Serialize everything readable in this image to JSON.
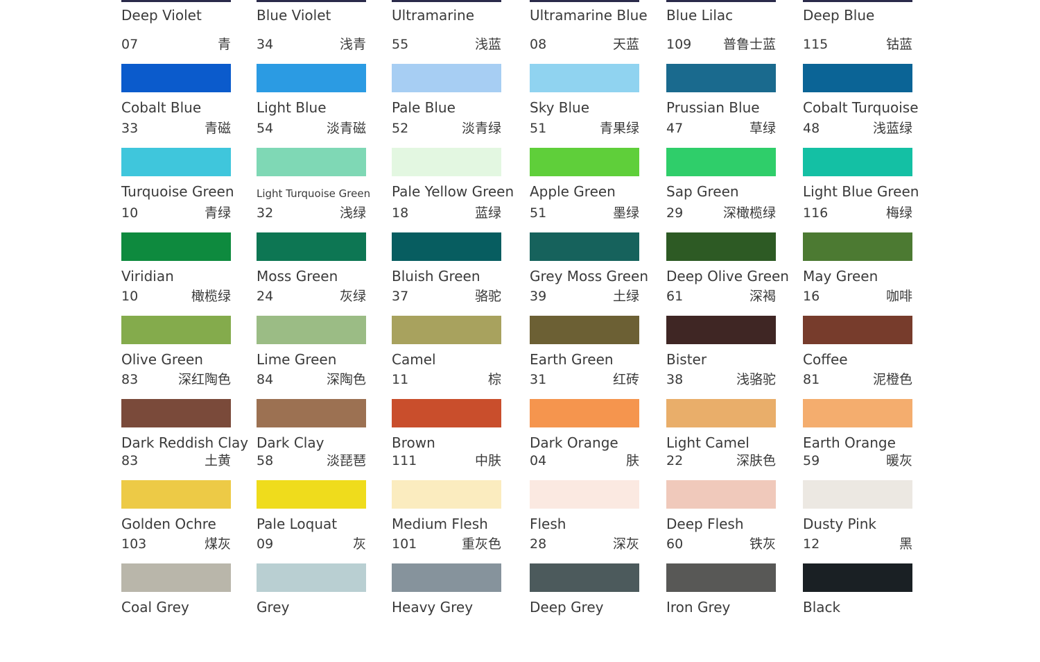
{
  "top_row": [
    {
      "name": "Deep Violet"
    },
    {
      "name": "Blue Violet"
    },
    {
      "name": "Ultramarine"
    },
    {
      "name": "Ultramarine Blue"
    },
    {
      "name": "Blue Lilac"
    },
    {
      "name": "Deep Blue"
    }
  ],
  "rows": [
    [
      {
        "code": "07",
        "cn": "青",
        "color": "#0b5bcc",
        "name": "Cobalt Blue"
      },
      {
        "code": "34",
        "cn": "浅青",
        "color": "#2b9be3",
        "name": "Light Blue"
      },
      {
        "code": "55",
        "cn": "浅蓝",
        "color": "#a7cef3",
        "name": "Pale Blue"
      },
      {
        "code": "08",
        "cn": "天蓝",
        "color": "#90d3f0",
        "name": "Sky Blue"
      },
      {
        "code": "109",
        "cn": "普鲁士蓝",
        "color": "#1a6a8e",
        "name": "Prussian Blue"
      },
      {
        "code": "115",
        "cn": "钴蓝",
        "color": "#0b6496",
        "name": "Cobalt Turquoise"
      }
    ],
    [
      {
        "code": "33",
        "cn": "青磁",
        "color": "#3fc6dc",
        "name": "Turquoise Green"
      },
      {
        "code": "54",
        "cn": "淡青磁",
        "color": "#7fd8b5",
        "name": "Light Turquoise Green"
      },
      {
        "code": "52",
        "cn": "淡青绿",
        "color": "#e3f7e1",
        "name": "Pale Yellow Green"
      },
      {
        "code": "51",
        "cn": "青果绿",
        "color": "#5fcf3a",
        "name": "Apple Green"
      },
      {
        "code": "47",
        "cn": "草绿",
        "color": "#2fce6a",
        "name": "Sap Green"
      },
      {
        "code": "48",
        "cn": "浅蓝绿",
        "color": "#14c0a4",
        "name": "Light Blue Green"
      }
    ],
    [
      {
        "code": "10",
        "cn": "青绿",
        "color": "#0e8a3e",
        "name": "Viridian"
      },
      {
        "code": "32",
        "cn": "浅绿",
        "color": "#0d7653",
        "name": "Moss Green"
      },
      {
        "code": "18",
        "cn": "蓝绿",
        "color": "#075d60",
        "name": "Bluish Green"
      },
      {
        "code": "51",
        "cn": "墨绿",
        "color": "#16625c",
        "name": "Grey Moss Green"
      },
      {
        "code": "29",
        "cn": "深橄榄绿",
        "color": "#2d5a24",
        "name": "Deep Olive Green"
      },
      {
        "code": "116",
        "cn": "梅绿",
        "color": "#4c7a32",
        "name": "May Green"
      }
    ],
    [
      {
        "code": "10",
        "cn": "橄榄绿",
        "color": "#84ab4c",
        "name": "Olive Green"
      },
      {
        "code": "24",
        "cn": "灰绿",
        "color": "#9bbc85",
        "name": "Lime Green"
      },
      {
        "code": "37",
        "cn": "骆驼",
        "color": "#a8a25e",
        "name": "Camel"
      },
      {
        "code": "39",
        "cn": "土绿",
        "color": "#6c6034",
        "name": "Earth Green"
      },
      {
        "code": "61",
        "cn": "深褐",
        "color": "#3f2624",
        "name": "Bister"
      },
      {
        "code": "16",
        "cn": "咖啡",
        "color": "#773c2c",
        "name": "Coffee"
      }
    ],
    [
      {
        "code": "83",
        "cn": "深红陶色",
        "color": "#7a4a3a",
        "name": "Dark Reddish Clay"
      },
      {
        "code": "84",
        "cn": "深陶色",
        "color": "#9c7152",
        "name": "Dark Clay"
      },
      {
        "code": "11",
        "cn": "棕",
        "color": "#c94e2c",
        "name": "Brown"
      },
      {
        "code": "31",
        "cn": "红砖",
        "color": "#f5954e",
        "name": "Dark Orange"
      },
      {
        "code": "38",
        "cn": "浅骆驼",
        "color": "#e9ae6a",
        "name": "Light Camel"
      },
      {
        "code": "81",
        "cn": "泥橙色",
        "color": "#f4ad6e",
        "name": "Earth Orange"
      }
    ],
    [
      {
        "code": "83",
        "cn": "土黄",
        "color": "#edca46",
        "name": "Golden Ochre"
      },
      {
        "code": "58",
        "cn": "淡琵琶",
        "color": "#efdc1c",
        "name": "Pale Loquat"
      },
      {
        "code": "111",
        "cn": "中肤",
        "color": "#fbecbf",
        "name": "Medium Flesh"
      },
      {
        "code": "04",
        "cn": "肤",
        "color": "#fbe9e1",
        "name": "Flesh"
      },
      {
        "code": "22",
        "cn": "深肤色",
        "color": "#f0c9bb",
        "name": "Deep Flesh"
      },
      {
        "code": "59",
        "cn": "暖灰",
        "color": "#ece8e2",
        "name": "Dusty Pink"
      }
    ],
    [
      {
        "code": "103",
        "cn": "煤灰",
        "color": "#b9b6aa",
        "name": "Coal Grey"
      },
      {
        "code": "09",
        "cn": "灰",
        "color": "#b9cfd2",
        "name": "Grey"
      },
      {
        "code": "101",
        "cn": "重灰色",
        "color": "#86939c",
        "name": "Heavy Grey"
      },
      {
        "code": "28",
        "cn": "深灰",
        "color": "#4c5a5c",
        "name": "Deep Grey"
      },
      {
        "code": "60",
        "cn": "铁灰",
        "color": "#585856",
        "name": "Iron Grey"
      },
      {
        "code": "12",
        "cn": "黑",
        "color": "#1a2024",
        "name": "Black"
      }
    ]
  ]
}
